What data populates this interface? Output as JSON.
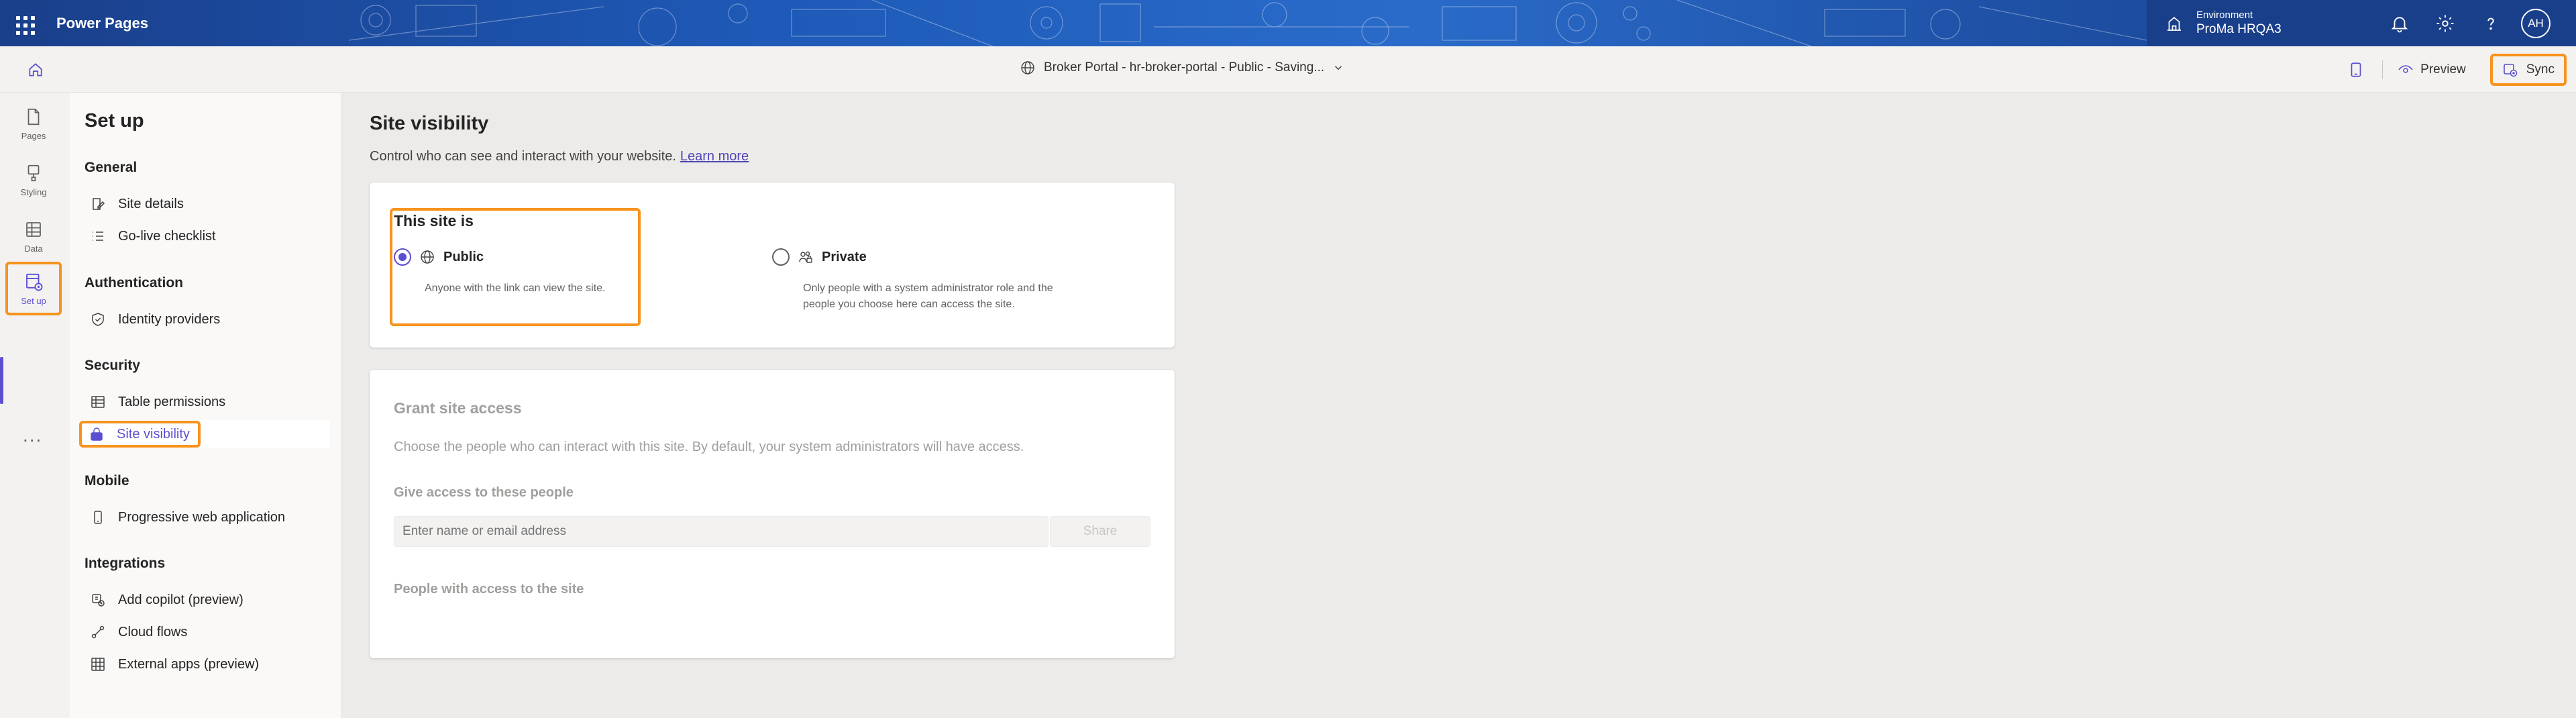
{
  "header": {
    "app_title": "Power Pages",
    "environment_label": "Environment",
    "environment_name": "ProMa HRQA3",
    "avatar_initials": "AH"
  },
  "command_bar": {
    "site_name": "Broker Portal - hr-broker-portal - Public - Saving...",
    "preview_label": "Preview",
    "sync_label": "Sync"
  },
  "rail": {
    "items": [
      {
        "label": "Pages",
        "icon": "page-icon"
      },
      {
        "label": "Styling",
        "icon": "brush-icon"
      },
      {
        "label": "Data",
        "icon": "table-icon"
      },
      {
        "label": "Set up",
        "icon": "setup-icon"
      }
    ],
    "more": "..."
  },
  "nav": {
    "title": "Set up",
    "sections": [
      {
        "title": "General",
        "items": [
          {
            "label": "Site details",
            "icon": "edit-document-icon"
          },
          {
            "label": "Go-live checklist",
            "icon": "checklist-icon"
          }
        ]
      },
      {
        "title": "Authentication",
        "items": [
          {
            "label": "Identity providers",
            "icon": "shield-icon"
          }
        ]
      },
      {
        "title": "Security",
        "items": [
          {
            "label": "Table permissions",
            "icon": "table-icon"
          },
          {
            "label": "Site visibility",
            "icon": "lock-icon"
          }
        ]
      },
      {
        "title": "Mobile",
        "items": [
          {
            "label": "Progressive web application",
            "icon": "phone-icon"
          }
        ]
      },
      {
        "title": "Integrations",
        "items": [
          {
            "label": "Add copilot (preview)",
            "icon": "copilot-icon"
          },
          {
            "label": "Cloud flows",
            "icon": "flow-icon"
          },
          {
            "label": "External apps (preview)",
            "icon": "grid-icon"
          }
        ]
      }
    ]
  },
  "main": {
    "title": "Site visibility",
    "description": "Control who can see and interact with your website.",
    "learn_more": "Learn more",
    "visibility": {
      "heading": "This site is",
      "public_label": "Public",
      "public_desc": "Anyone with the link can view the site.",
      "private_label": "Private",
      "private_desc_1": "Only people with a system administrator role and the",
      "private_desc_2": "people you choose here can access the site.",
      "selected": "Public"
    },
    "grant": {
      "title": "Grant site access",
      "description": "Choose the people who can interact with this site. By default, your system administrators will have access.",
      "give_access_label": "Give access to these people",
      "input_placeholder": "Enter name or email address",
      "share_label": "Share",
      "people_label": "People with access to the site"
    }
  },
  "colors": {
    "accent": "#5b4fd0",
    "highlight": "#f7931e",
    "header_bg": "#1e5ab8"
  }
}
